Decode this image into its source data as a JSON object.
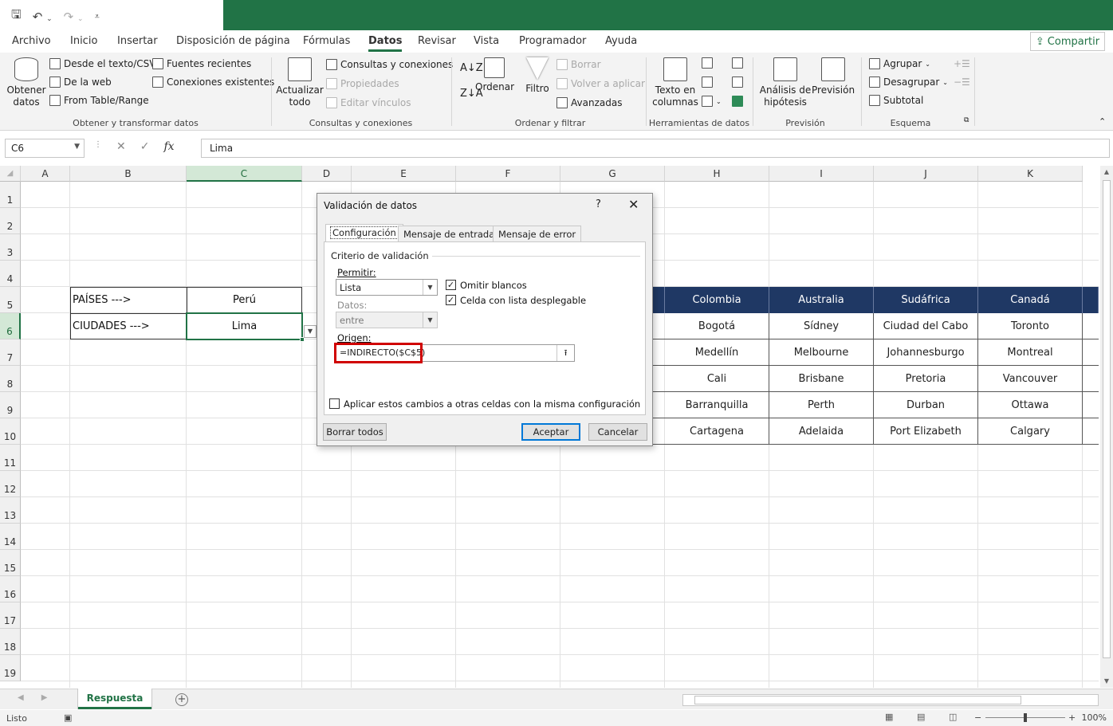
{
  "ribbon_tabs": [
    "Archivo",
    "Inicio",
    "Insertar",
    "Disposición de página",
    "Fórmulas",
    "Datos",
    "Revisar",
    "Vista",
    "Programador",
    "Ayuda"
  ],
  "active_tab": "Datos",
  "share_label": "Compartir",
  "ribbon": {
    "obtener_datos": "Obtener datos",
    "desde_texto": "Desde el texto/CSV",
    "de_la_web": "De la web",
    "from_table": "From Table/Range",
    "fuentes_recientes": "Fuentes recientes",
    "conexiones_existentes": "Conexiones existentes",
    "grp_obtener": "Obtener y transformar datos",
    "actualizar_todo": "Actualizar todo",
    "consultas_conexiones": "Consultas y conexiones",
    "propiedades": "Propiedades",
    "editar_vinculos": "Editar vínculos",
    "grp_consultas": "Consultas y conexiones",
    "ordenar": "Ordenar",
    "filtro": "Filtro",
    "borrar": "Borrar",
    "volver_aplicar": "Volver a aplicar",
    "avanzadas": "Avanzadas",
    "grp_ordenar": "Ordenar y filtrar",
    "texto_columnas": "Texto en columnas",
    "grp_herramientas": "Herramientas de datos",
    "analisis_hipotesis": "Análisis de hipótesis",
    "prevision": "Previsión",
    "grp_prevision": "Previsión",
    "agrupar": "Agrupar",
    "desagrupar": "Desagrupar",
    "subtotal": "Subtotal",
    "grp_esquema": "Esquema"
  },
  "formula_bar": {
    "name_box": "C6",
    "formula": "Lima"
  },
  "columns": [
    {
      "label": "A",
      "w": 62
    },
    {
      "label": "B",
      "w": 146
    },
    {
      "label": "C",
      "w": 145
    },
    {
      "label": "D",
      "w": 62
    },
    {
      "label": "E",
      "w": 131
    },
    {
      "label": "F",
      "w": 131
    },
    {
      "label": "G",
      "w": 131
    },
    {
      "label": "H",
      "w": 131
    },
    {
      "label": "I",
      "w": 131
    },
    {
      "label": "J",
      "w": 131
    },
    {
      "label": "K",
      "w": 131
    }
  ],
  "rows": [
    "1",
    "2",
    "3",
    "4",
    "5",
    "6",
    "7",
    "8",
    "9",
    "10",
    "11",
    "12",
    "13",
    "14",
    "15",
    "16",
    "17",
    "18",
    "19"
  ],
  "cells": {
    "b5": "PAÍSES --->",
    "b6": "CIUDADES --->",
    "c5": "Perú",
    "c6": "Lima"
  },
  "country_table": {
    "headers": [
      "Colombia",
      "Australia",
      "Sudáfrica",
      "Canadá"
    ],
    "rows": [
      [
        "Bogotá",
        "Sídney",
        "Ciudad del Cabo",
        "Toronto"
      ],
      [
        "Medellín",
        "Melbourne",
        "Johannesburgo",
        "Montreal"
      ],
      [
        "Cali",
        "Brisbane",
        "Pretoria",
        "Vancouver"
      ],
      [
        "Barranquilla",
        "Perth",
        "Durban",
        "Ottawa"
      ],
      [
        "Cartagena",
        "Adelaida",
        "Port Elizabeth",
        "Calgary"
      ]
    ],
    "header_color": "#1f3864"
  },
  "dialog": {
    "title": "Validación de datos",
    "help": "?",
    "close": "✕",
    "tabs": [
      "Configuración",
      "Mensaje de entrada",
      "Mensaje de error"
    ],
    "criteria_title": "Criterio de validación",
    "permitir_label": "Permitir:",
    "permitir_value": "Lista",
    "omitir_blancos": "Omitir blancos",
    "celda_lista": "Celda con lista desplegable",
    "datos_label": "Datos:",
    "datos_value": "entre",
    "origen_label": "Origen:",
    "origen_value": "=INDIRECTO($C$5)",
    "aplicar_cambios": "Aplicar estos cambios a otras celdas con la misma configuración",
    "borrar_todos": "Borrar todos",
    "aceptar": "Aceptar",
    "cancelar": "Cancelar"
  },
  "sheet_tab": "Respuesta",
  "status": {
    "ready": "Listo",
    "zoom": "100%"
  },
  "accent_color": "#217346"
}
